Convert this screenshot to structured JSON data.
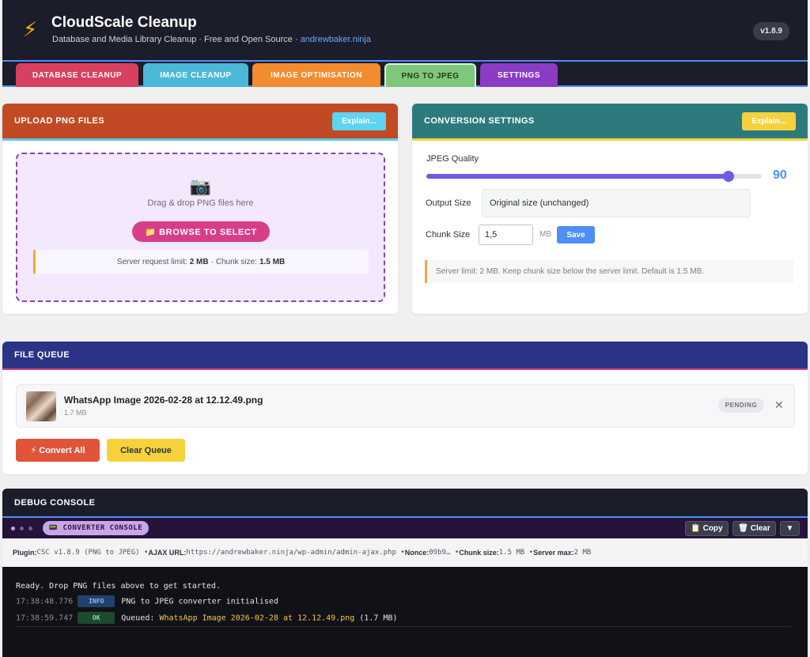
{
  "header": {
    "title": "CloudScale Cleanup",
    "subtitle": "Database and Media Library Cleanup · Free and Open Source · ",
    "subtitle_link": "andrewbaker.ninja",
    "version": "v1.8.9"
  },
  "tabs": [
    {
      "label": "Database Cleanup"
    },
    {
      "label": "Image Cleanup"
    },
    {
      "label": "Image Optimisation"
    },
    {
      "label": "PNG to JPEG"
    },
    {
      "label": "Settings"
    }
  ],
  "active_tab": "PNG to JPEG",
  "upload": {
    "title": "Upload PNG Files",
    "explain": "Explain...",
    "drop_text": "Drag & drop PNG files here",
    "browse": "📁 Browse to Select",
    "limit_prefix": "Server request limit:",
    "limit_value": "2 MB",
    "chunk_prefix": "· Chunk size:",
    "chunk_value": "1.5 MB"
  },
  "settings": {
    "title": "Conversion Settings",
    "explain": "Explain...",
    "quality_label": "JPEG Quality",
    "quality_value": "90",
    "quality_fraction": 0.9,
    "output_label": "Output Size",
    "output_value": "Original size (unchanged)",
    "chunk_label": "Chunk Size",
    "chunk_value": "1,5",
    "chunk_unit": "MB",
    "save": "Save",
    "server_note": "Server limit: 2 MB. Keep chunk size below the server limit. Default is 1.5 MB."
  },
  "queue": {
    "title": "File Queue",
    "items": [
      {
        "name": "WhatsApp Image 2026-02-28 at 12.12.49.png",
        "size": "1.7 MB",
        "status": "PENDING"
      }
    ],
    "convert_all": "⚡ Convert All",
    "clear_queue": "Clear Queue"
  },
  "debug": {
    "title": "Debug Console",
    "console_label": "📟 CONVERTER CONSOLE",
    "copy": "📋 Copy",
    "clear": "🗑 Clear",
    "toggle": "▼",
    "meta": {
      "plugin_label": "Plugin:",
      "plugin_value": " CSC v1.8.9 (PNG to JPEG) • ",
      "ajax_label": "AJAX URL:",
      "ajax_value": " https://andrewbaker.ninja/wp-admin/admin-ajax.php • ",
      "nonce_label": "Nonce:",
      "nonce_value": " 09b9… • ",
      "chunk_label": "Chunk size:",
      "chunk_value": " 1.5 MB • ",
      "server_label": "Server max:",
      "server_value": " 2 MB"
    },
    "ready_line": "Ready. Drop PNG files above to get started.",
    "logs": [
      {
        "time": "17:38:48.776",
        "level": "INFO",
        "text": "PNG to JPEG converter initialised",
        "highlight": "",
        "suffix": ""
      },
      {
        "time": "17:38:59.747",
        "level": "OK",
        "text": "Queued: ",
        "highlight": "WhatsApp Image 2026-02-28 at 12.12.49.png",
        "suffix": " (1.7 MB)"
      }
    ]
  },
  "colors": {
    "accent": "#4f8ef7",
    "header_bg": "#1c1d2b",
    "upload_head": "#c14a24",
    "settings_head": "#2d7a7c",
    "queue_head": "#2b3387"
  }
}
